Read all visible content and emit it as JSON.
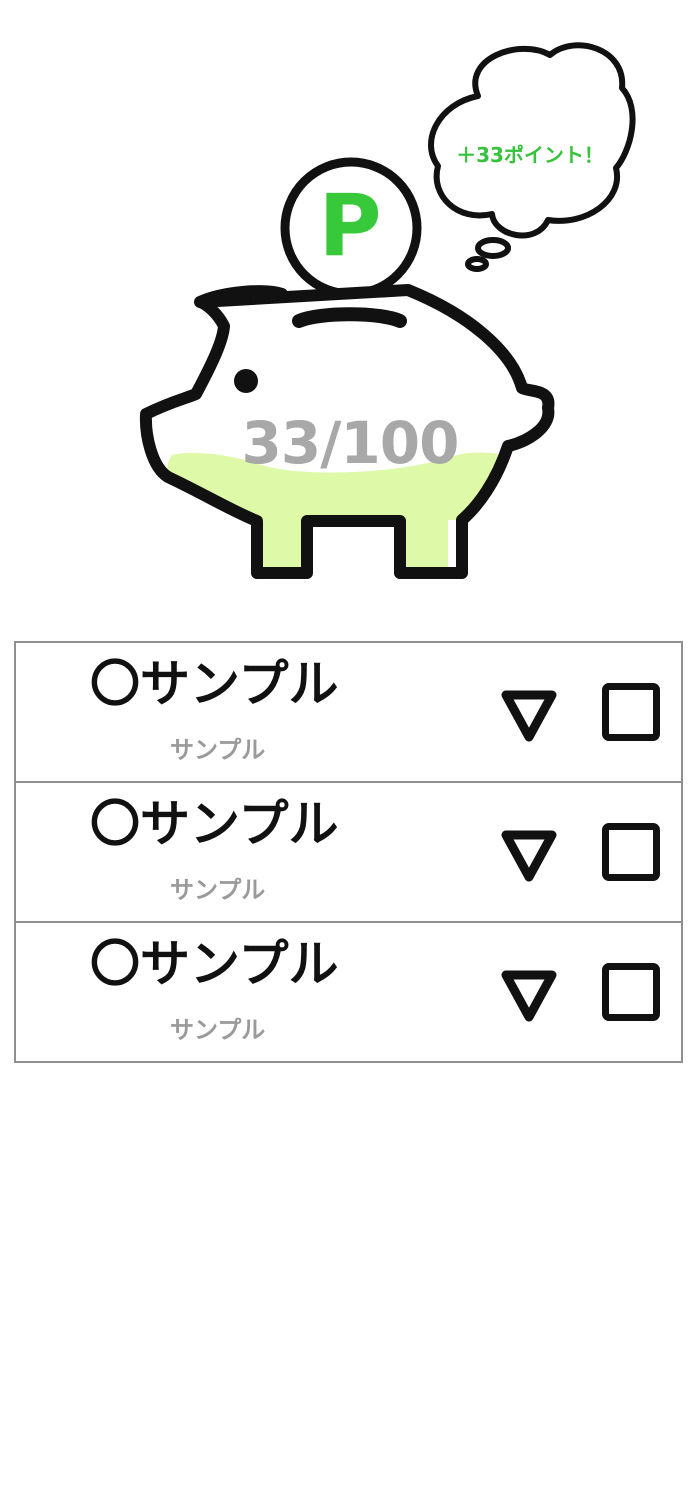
{
  "savings": {
    "coin_label": "P",
    "bonus_text": "＋33ポイント！",
    "progress_text": "33/100",
    "progress_fraction": 0.33,
    "colors": {
      "accent": "#37c93a",
      "fill": "#def9a8",
      "outline": "#111111",
      "progress_text": "#a8a8a8"
    },
    "icons": [
      "piggy-bank-icon",
      "coin-icon",
      "thought-bubble-icon"
    ]
  },
  "list": {
    "items": [
      {
        "title": "〇サンプル",
        "subtitle": "サンプル",
        "expand_icon": "triangle-down-icon",
        "checkbox_icon": "checkbox-icon"
      },
      {
        "title": "〇サンプル",
        "subtitle": "サンプル",
        "expand_icon": "triangle-down-icon",
        "checkbox_icon": "checkbox-icon"
      },
      {
        "title": "〇サンプル",
        "subtitle": "サンプル",
        "expand_icon": "triangle-down-icon",
        "checkbox_icon": "checkbox-icon"
      }
    ]
  }
}
